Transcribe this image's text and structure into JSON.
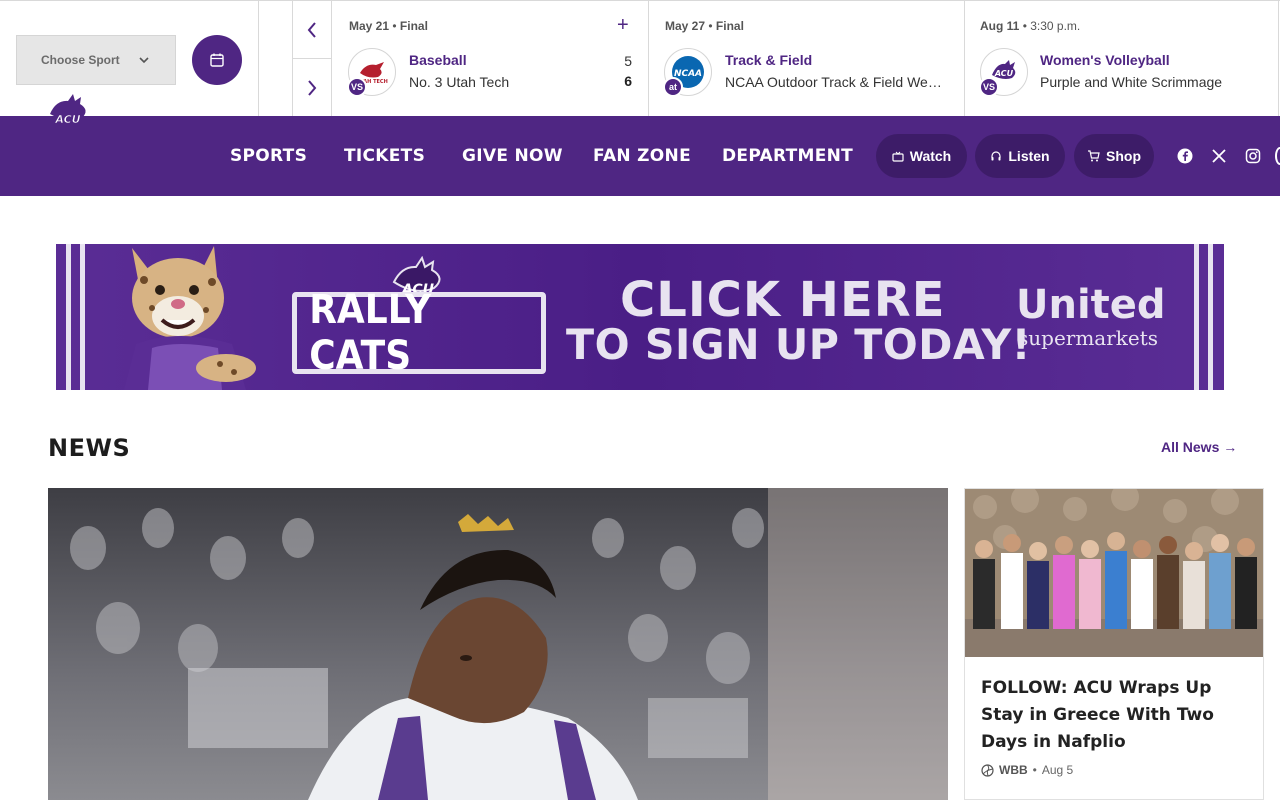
{
  "scoreboard": {
    "sport_select_label": "Choose Sport",
    "games": [
      {
        "date": "May 21",
        "status": "Final",
        "location": "VS",
        "sport": "Baseball",
        "opponent": "No. 3 Utah Tech",
        "opponent_logo_text": "UTAH TECH",
        "score_home": "5",
        "score_away": "6"
      },
      {
        "date": "May 27",
        "status": "Final",
        "location": "at",
        "sport": "Track & Field",
        "opponent": "NCAA Outdoor Track & Field Wes...",
        "opponent_logo_text": "NCAA"
      },
      {
        "date": "Aug 11",
        "status": "3:30 p.m.",
        "location": "VS",
        "sport": "Women's Volleyball",
        "opponent": "Purple and White Scrimmage",
        "opponent_logo_text": "ACU"
      }
    ]
  },
  "nav": {
    "links": [
      "SPORTS",
      "TICKETS",
      "GIVE NOW",
      "FAN ZONE",
      "DEPARTMENT"
    ],
    "watch": "Watch",
    "listen": "Listen",
    "shop": "Shop",
    "social_icons": [
      "facebook-icon",
      "x-icon",
      "instagram-icon"
    ]
  },
  "banner": {
    "logo_text": "ACU",
    "program": "RALLY CATS",
    "cta_line1": "CLICK HERE",
    "cta_line2": "TO SIGN UP TODAY!",
    "sponsor_line1": "United",
    "sponsor_line2": "supermarkets"
  },
  "news": {
    "title": "NEWS",
    "all_news": "All News →",
    "side_story": {
      "title": "FOLLOW: ACU Wraps Up Stay in Greece With Two Days in Nafplio",
      "sport": "WBB",
      "date": "Aug 5"
    }
  },
  "colors": {
    "primary_purple": "#4f2683",
    "dark_purple": "#3d1c68"
  }
}
